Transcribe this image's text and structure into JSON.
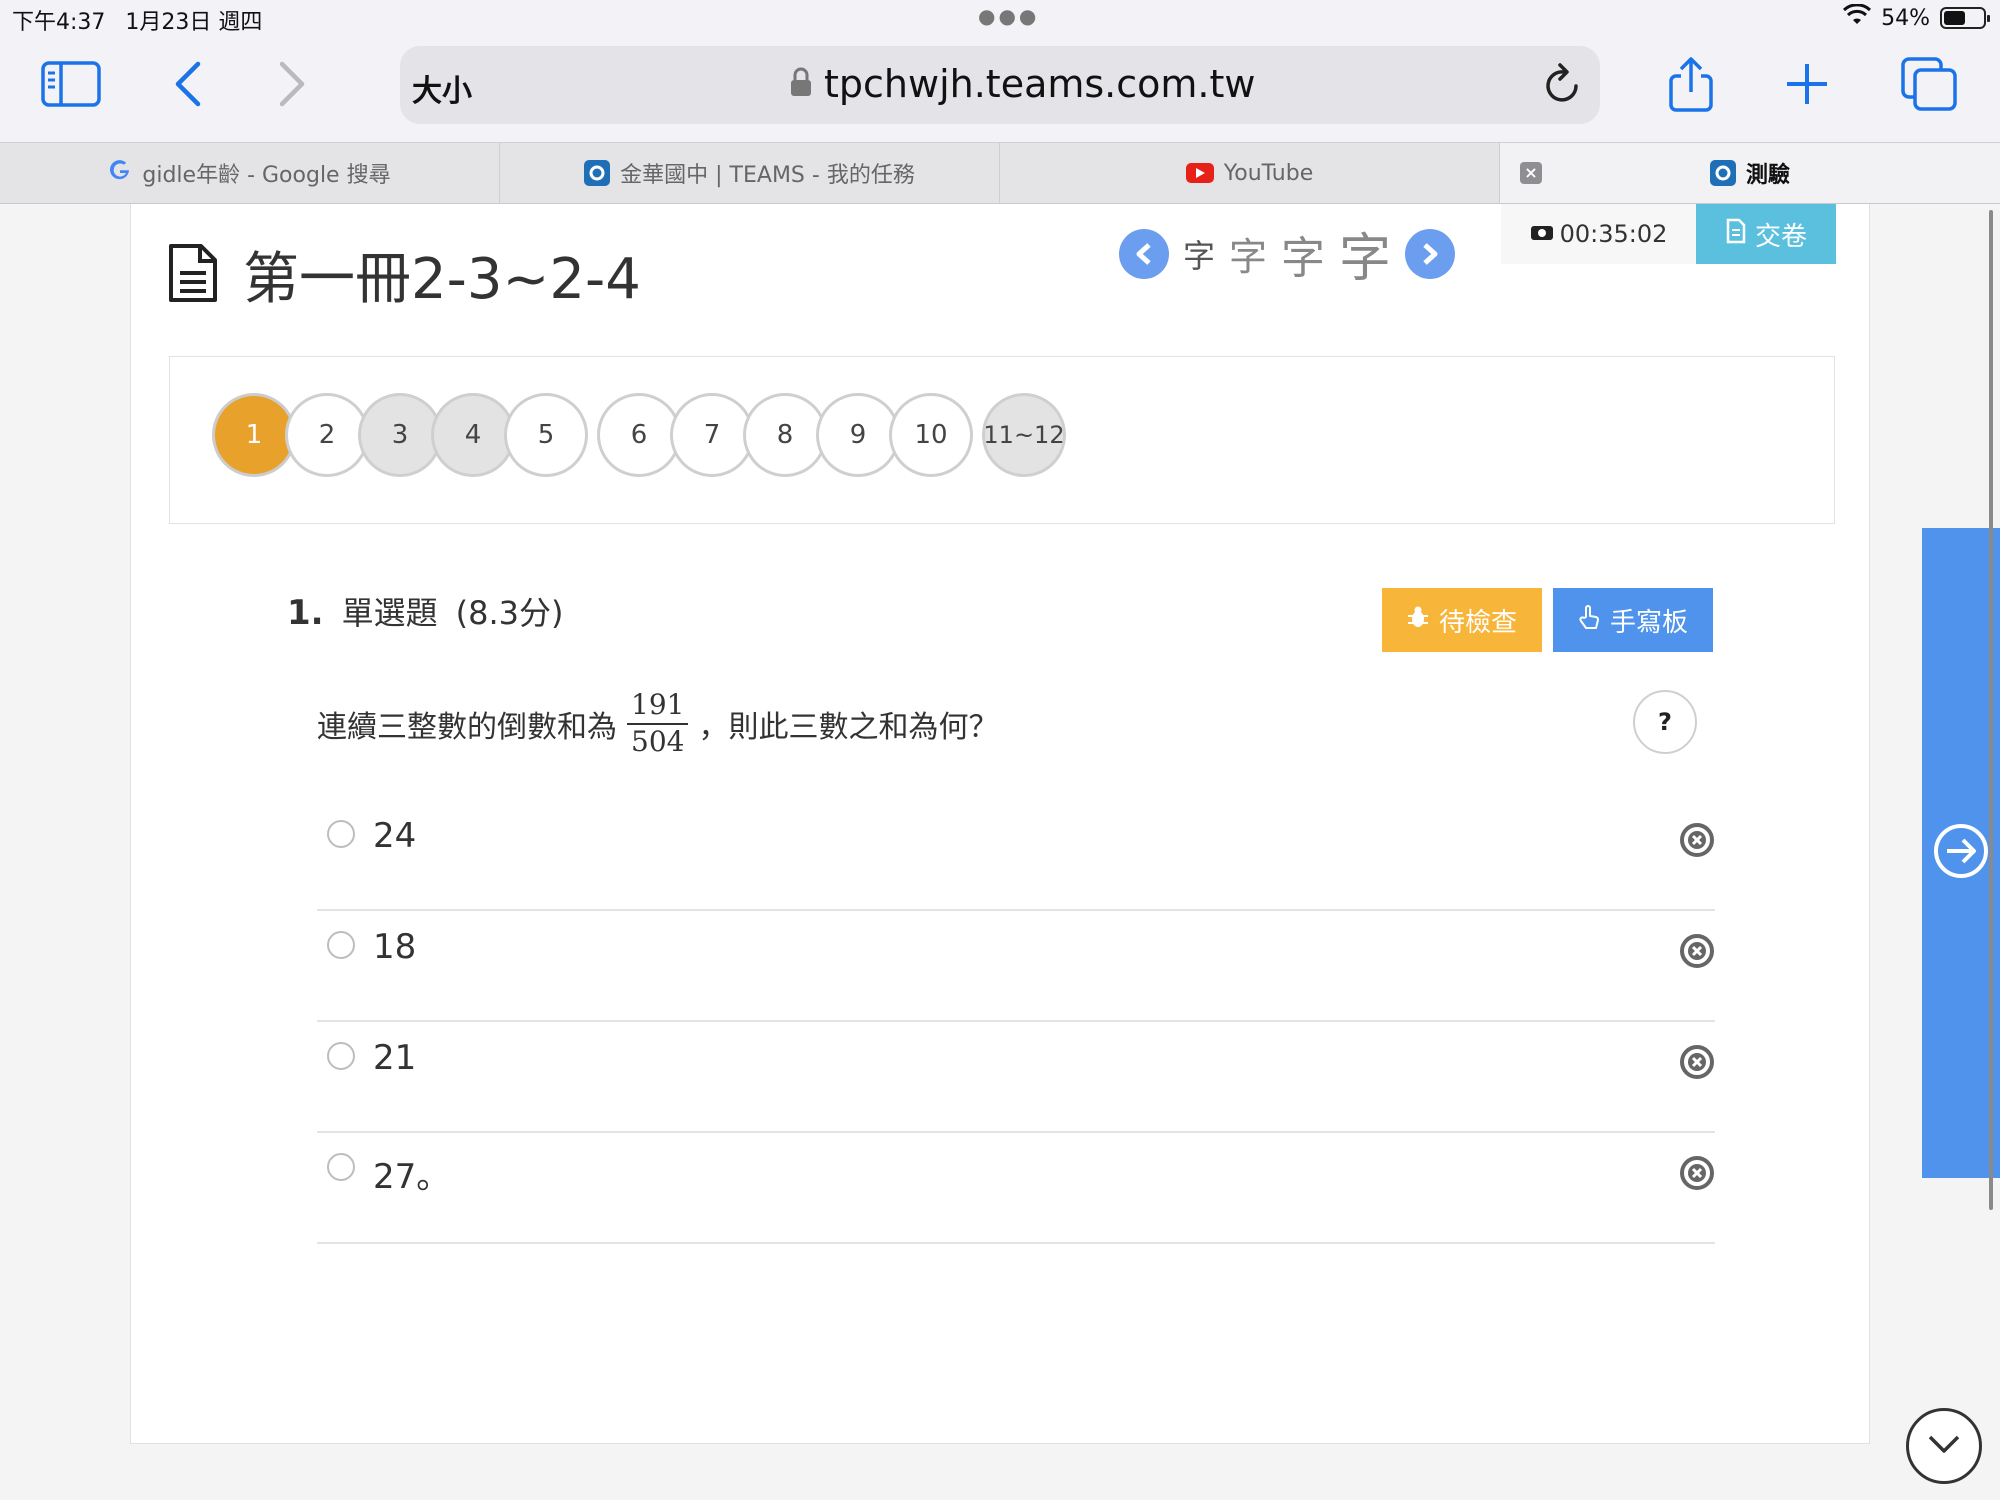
{
  "status_bar": {
    "time": "下午4:37",
    "date": "1月23日 週四",
    "battery_pct": "54%",
    "battery_level": 0.54
  },
  "toolbar": {
    "reader_label": "大小",
    "url": "tpchwjh.teams.com.tw"
  },
  "tabs": [
    {
      "label": "gidle年齡 - Google 搜尋",
      "icon": "google-icon"
    },
    {
      "label": "金華國中 | TEAMS - 我的任務",
      "icon": "teams-icon"
    },
    {
      "label": "YouTube",
      "icon": "youtube-icon"
    },
    {
      "label": "測驗",
      "icon": "teams-icon",
      "active": true
    }
  ],
  "page": {
    "title": "第一冊2-3~2-4",
    "font_sizes_label": [
      "字",
      "字",
      "字",
      "字"
    ],
    "timer": "00:35:02",
    "submit_label": "交卷",
    "questions_nav": [
      "1",
      "2",
      "3",
      "4",
      "5",
      "6",
      "7",
      "8",
      "9",
      "10",
      "11~12"
    ],
    "question": {
      "number": "1.",
      "type": "單選題",
      "points": "(8.3分)",
      "review_label": "待檢查",
      "handwrite_label": "手寫板",
      "text_before": "連續三整數的倒數和為",
      "frac_num": "191",
      "frac_den": "504",
      "text_after": "，則此三數之和為何？",
      "help": "?",
      "options": [
        "24",
        "18",
        "21",
        "27。"
      ]
    }
  },
  "colors": {
    "accent": "#4f93ec",
    "current_question": "#e8a22c",
    "review": "#f7b53a",
    "submit": "#5bc0de"
  }
}
